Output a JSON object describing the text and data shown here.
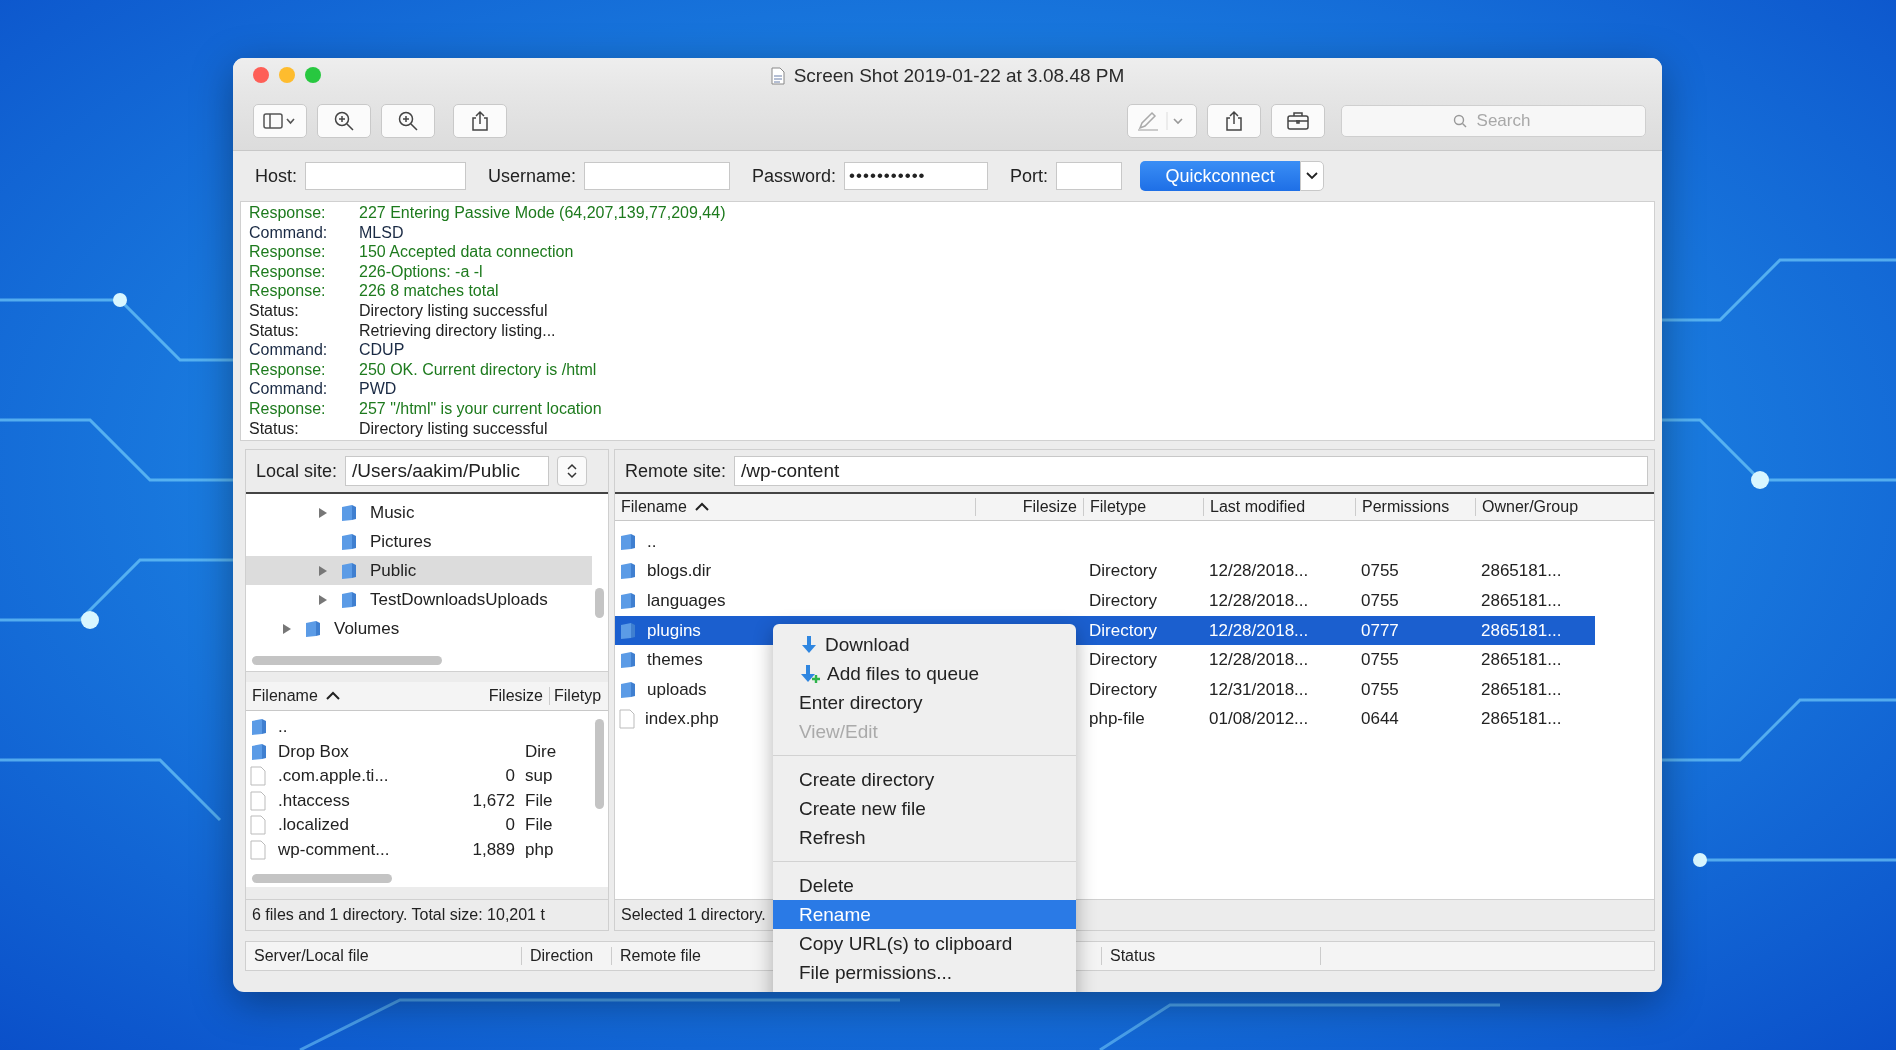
{
  "window": {
    "title": "Screen Shot 2019-01-22 at 3.08.48 PM"
  },
  "toolbar": {
    "search": {
      "placeholder": "Search"
    }
  },
  "connection": {
    "host_label": "Host:",
    "username_label": "Username:",
    "password_label": "Password:",
    "password": "•••••••••••",
    "port_label": "Port:",
    "quickconnect": "Quickconnect"
  },
  "log": [
    {
      "kind": "response",
      "label": "Response:",
      "message": "227 Entering Passive Mode (64,207,139,77,209,44)"
    },
    {
      "kind": "command",
      "label": "Command:",
      "message": "MLSD"
    },
    {
      "kind": "response",
      "label": "Response:",
      "message": "150 Accepted data connection"
    },
    {
      "kind": "response",
      "label": "Response:",
      "message": "226-Options: -a -l"
    },
    {
      "kind": "response",
      "label": "Response:",
      "message": "226 8 matches total"
    },
    {
      "kind": "status",
      "label": "Status:",
      "message": "Directory listing successful"
    },
    {
      "kind": "status",
      "label": "Status:",
      "message": "Retrieving directory listing..."
    },
    {
      "kind": "command",
      "label": "Command:",
      "message": "CDUP"
    },
    {
      "kind": "response",
      "label": "Response:",
      "message": "250 OK. Current directory is /html"
    },
    {
      "kind": "command",
      "label": "Command:",
      "message": "PWD"
    },
    {
      "kind": "response",
      "label": "Response:",
      "message": "257 \"/html\" is your current location"
    },
    {
      "kind": "status",
      "label": "Status:",
      "message": "Directory listing successful"
    }
  ],
  "local": {
    "site_label": "Local site:",
    "path": "/Users/aakim/Public",
    "tree": [
      {
        "children": [
          {
            "label": "Music",
            "expandable": true,
            "selected": false
          },
          {
            "label": "Pictures",
            "expandable": false,
            "selected": false
          },
          {
            "label": "Public",
            "expandable": true,
            "selected": true
          },
          {
            "label": "TestDownloadsUploads",
            "expandable": true,
            "selected": false
          }
        ]
      },
      {
        "label": "Volumes",
        "expandable": true,
        "selected": false
      }
    ],
    "columns": [
      "Filename",
      "Filesize",
      "Filetyp"
    ],
    "files": [
      {
        "kind": "folder",
        "name": ".."
      },
      {
        "kind": "folder",
        "name": "Drop Box",
        "type": "Dire"
      },
      {
        "kind": "file",
        "name": ".com.apple.ti...",
        "size": "0",
        "type": "sup"
      },
      {
        "kind": "file",
        "name": ".htaccess",
        "size": "1,672",
        "type": "File"
      },
      {
        "kind": "file",
        "name": ".localized",
        "size": "0",
        "type": "File"
      },
      {
        "kind": "file",
        "name": "wp-comment...",
        "size": "1,889",
        "type": "php"
      }
    ],
    "status": "6 files and 1 directory. Total size: 10,201 t"
  },
  "remote": {
    "site_label": "Remote site:",
    "path": "/wp-content",
    "columns": [
      "Filename",
      "Filesize",
      "Filetype",
      "Last modified",
      "Permissions",
      "Owner/Group"
    ],
    "files": [
      {
        "kind": "folder",
        "name": "..",
        "selected": false
      },
      {
        "kind": "folder",
        "name": "blogs.dir",
        "type": "Directory",
        "modified": "12/28/2018...",
        "permissions": "0755",
        "owner": "2865181...",
        "selected": false
      },
      {
        "kind": "folder",
        "name": "languages",
        "type": "Directory",
        "modified": "12/28/2018...",
        "permissions": "0755",
        "owner": "2865181...",
        "selected": false
      },
      {
        "kind": "folder",
        "name": "plugins",
        "type": "Directory",
        "modified": "12/28/2018...",
        "permissions": "0777",
        "owner": "2865181...",
        "selected": true
      },
      {
        "kind": "folder",
        "name": "themes",
        "type": "Directory",
        "modified": "12/28/2018...",
        "permissions": "0755",
        "owner": "2865181...",
        "selected": false
      },
      {
        "kind": "folder",
        "name": "uploads",
        "type": "Directory",
        "modified": "12/31/2018...",
        "permissions": "0755",
        "owner": "2865181...",
        "selected": false
      },
      {
        "kind": "file",
        "name": "index.php",
        "type": "php-file",
        "modified": "01/08/2012...",
        "permissions": "0644",
        "owner": "2865181...",
        "selected": false
      }
    ],
    "status": "Selected 1 directory."
  },
  "queue": {
    "columns": [
      "Server/Local file",
      "Direction",
      "Remote file",
      "Status"
    ]
  },
  "context_menu": [
    {
      "kind": "item",
      "label": "Download",
      "has_icon": true,
      "disabled": false,
      "selected": false
    },
    {
      "kind": "item",
      "label": "Add files to queue",
      "has_icon": true,
      "disabled": false,
      "selected": false
    },
    {
      "kind": "item",
      "label": "Enter directory",
      "has_icon": false,
      "disabled": false,
      "selected": false
    },
    {
      "kind": "item",
      "label": "View/Edit",
      "has_icon": false,
      "disabled": true,
      "selected": false
    },
    {
      "kind": "separator"
    },
    {
      "kind": "item",
      "label": "Create directory",
      "has_icon": false,
      "disabled": false,
      "selected": false
    },
    {
      "kind": "item",
      "label": "Create new file",
      "has_icon": false,
      "disabled": false,
      "selected": false
    },
    {
      "kind": "item",
      "label": "Refresh",
      "has_icon": false,
      "disabled": false,
      "selected": false
    },
    {
      "kind": "separator"
    },
    {
      "kind": "item",
      "label": "Delete",
      "has_icon": false,
      "disabled": false,
      "selected": false
    },
    {
      "kind": "item",
      "label": "Rename",
      "has_icon": false,
      "disabled": false,
      "selected": true
    },
    {
      "kind": "item",
      "label": "Copy URL(s) to clipboard",
      "has_icon": false,
      "disabled": false,
      "selected": false
    },
    {
      "kind": "item",
      "label": "File permissions...",
      "has_icon": false,
      "disabled": false,
      "selected": false
    }
  ]
}
